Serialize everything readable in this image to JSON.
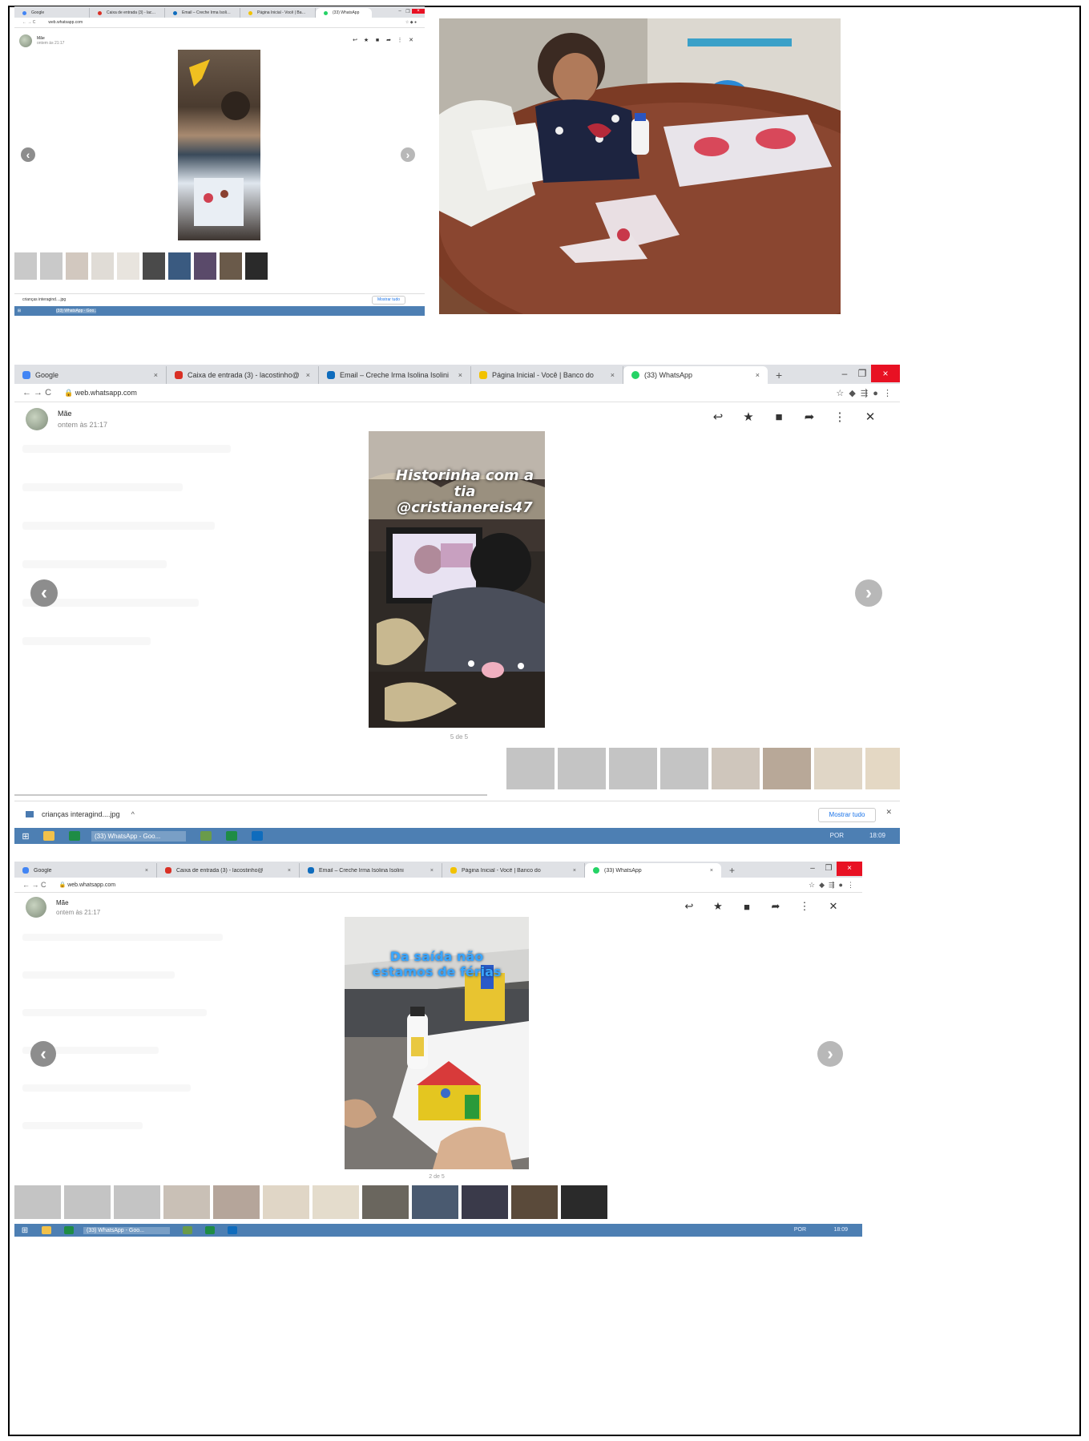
{
  "browser": {
    "tabs": [
      {
        "label": "Google",
        "icon": "google-icon"
      },
      {
        "label": "Caixa de entrada (3) - lacostinho@",
        "icon": "gmail-icon"
      },
      {
        "label": "Email – Creche Irma Isolina Isolini",
        "icon": "outlook-icon"
      },
      {
        "label": "Página Inicial - Você | Banco do",
        "icon": "bank-icon"
      },
      {
        "label": "(33) WhatsApp",
        "icon": "whatsapp-icon"
      }
    ],
    "new_tab": "+",
    "url": "web.whatsapp.com",
    "close_tab": "×",
    "window": {
      "minimize": "–",
      "restore": "❐",
      "close": "×"
    }
  },
  "viewer": {
    "sender_name": "Mãe",
    "sender_time": "ontem às 21:17",
    "actions": [
      "↩",
      "★",
      "■",
      "➦",
      "⋮",
      "✕"
    ],
    "prev": "‹",
    "next": "›"
  },
  "shot_a": {
    "counter": ""
  },
  "shot_b": {
    "counter": "5 de 5",
    "overlay": "Historinha com a tia @cristianereis47",
    "download_file": "crianças interagind....jpg",
    "download_chevron": "^",
    "show_all": "Mostrar tudo",
    "download_close": "✕",
    "taskbar_app": "(33) WhatsApp - Goo...",
    "tray_text": "POR",
    "tray_time": "18:09"
  },
  "shot_c": {
    "counter": "2 de 5",
    "overlay": "Da saída não estamos de férias",
    "taskbar_app": "(33) WhatsApp - Goo...",
    "tray_text": "POR",
    "tray_time": "18:09"
  },
  "colors": {
    "tab_bar": "#dfe1e5",
    "taskbar": "#4d7fb3",
    "close_red": "#e81123",
    "link_blue": "#1a73e8"
  }
}
